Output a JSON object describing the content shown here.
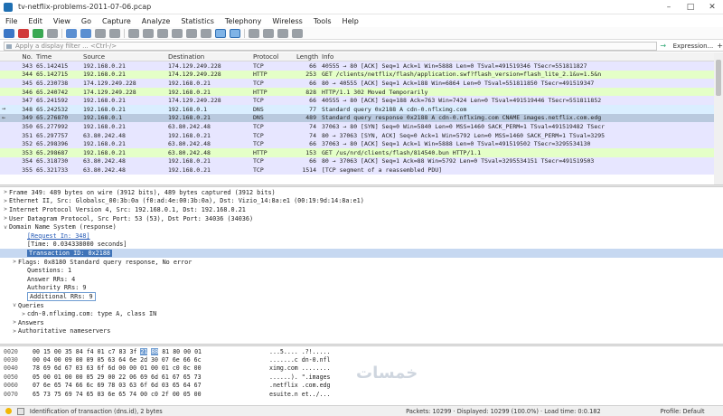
{
  "window": {
    "title": "tv-netflix-problems-2011-07-06.pcap"
  },
  "menu": [
    "File",
    "Edit",
    "View",
    "Go",
    "Capture",
    "Analyze",
    "Statistics",
    "Telephony",
    "Wireless",
    "Tools",
    "Help"
  ],
  "filter": {
    "placeholder": "Apply a display filter ... <Ctrl-/>",
    "expression_label": "Expression...",
    "plus": "+"
  },
  "packet_list": {
    "columns": [
      "No.",
      "Time",
      "Source",
      "Destination",
      "Protocol",
      "Length",
      "Info"
    ],
    "rows": [
      {
        "no": "343",
        "time": "65.142415",
        "src": "192.168.0.21",
        "dst": "174.129.249.228",
        "proto": "TCP",
        "len": "66",
        "info": "40555 → 80 [ACK] Seq=1 Ack=1 Win=5888 Len=0 TSval=491519346 TSecr=551811827",
        "kind": "tcp"
      },
      {
        "no": "344",
        "time": "65.142715",
        "src": "192.168.0.21",
        "dst": "174.129.249.228",
        "proto": "HTTP",
        "len": "253",
        "info": "GET /clients/netflix/flash/application.swf?flash_version=flash_lite_2.1&v=1.5&n",
        "kind": "http"
      },
      {
        "no": "345",
        "time": "65.230738",
        "src": "174.129.249.228",
        "dst": "192.168.0.21",
        "proto": "TCP",
        "len": "66",
        "info": "80 → 40555 [ACK] Seq=1 Ack=188 Win=6864 Len=0 TSval=551811850 TSecr=491519347",
        "kind": "tcp"
      },
      {
        "no": "346",
        "time": "65.240742",
        "src": "174.129.249.228",
        "dst": "192.168.0.21",
        "proto": "HTTP",
        "len": "828",
        "info": "HTTP/1.1 302 Moved Temporarily",
        "kind": "http"
      },
      {
        "no": "347",
        "time": "65.241592",
        "src": "192.168.0.21",
        "dst": "174.129.249.228",
        "proto": "TCP",
        "len": "66",
        "info": "40555 → 80 [ACK] Seq=188 Ack=763 Win=7424 Len=0 TSval=491519446 TSecr=551811852",
        "kind": "tcp"
      },
      {
        "no": "348",
        "time": "65.242532",
        "src": "192.168.0.21",
        "dst": "192.168.0.1",
        "proto": "DNS",
        "len": "77",
        "info": "Standard query 0x2188 A cdn-0.nflximg.com",
        "kind": "dns",
        "mark": "→"
      },
      {
        "no": "349",
        "time": "65.276870",
        "src": "192.168.0.1",
        "dst": "192.168.0.21",
        "proto": "DNS",
        "len": "489",
        "info": "Standard query response 0x2188 A cdn-0.nflximg.com CNAME images.netflix.com.edg",
        "kind": "sel",
        "mark": "←"
      },
      {
        "no": "350",
        "time": "65.277992",
        "src": "192.168.0.21",
        "dst": "63.80.242.48",
        "proto": "TCP",
        "len": "74",
        "info": "37063 → 80 [SYN] Seq=0 Win=5840 Len=0 MSS=1460 SACK_PERM=1 TSval=491519482 TSecr",
        "kind": "tcp"
      },
      {
        "no": "351",
        "time": "65.297757",
        "src": "63.80.242.48",
        "dst": "192.168.0.21",
        "proto": "TCP",
        "len": "74",
        "info": "80 → 37063 [SYN, ACK] Seq=0 Ack=1 Win=5792 Len=0 MSS=1460 SACK_PERM=1 TSval=3295",
        "kind": "tcp"
      },
      {
        "no": "352",
        "time": "65.298396",
        "src": "192.168.0.21",
        "dst": "63.80.242.48",
        "proto": "TCP",
        "len": "66",
        "info": "37063 → 80 [ACK] Seq=1 Ack=1 Win=5888 Len=0 TSval=491519502 TSecr=3295534130",
        "kind": "tcp"
      },
      {
        "no": "353",
        "time": "65.298687",
        "src": "192.168.0.21",
        "dst": "63.80.242.48",
        "proto": "HTTP",
        "len": "153",
        "info": "GET /us/nrd/clients/flash/814540.bun HTTP/1.1",
        "kind": "http"
      },
      {
        "no": "354",
        "time": "65.318730",
        "src": "63.80.242.48",
        "dst": "192.168.0.21",
        "proto": "TCP",
        "len": "66",
        "info": "80 → 37063 [ACK] Seq=1 Ack=88 Win=5792 Len=0 TSval=3295534151 TSecr=491519503",
        "kind": "tcp"
      },
      {
        "no": "355",
        "time": "65.321733",
        "src": "63.80.242.48",
        "dst": "192.168.0.21",
        "proto": "TCP",
        "len": "1514",
        "info": "[TCP segment of a reassembled PDU]",
        "kind": "tcp"
      }
    ]
  },
  "details": [
    {
      "indent": 0,
      "tw": ">",
      "text": "Frame 349: 489 bytes on wire (3912 bits), 489 bytes captured (3912 bits)"
    },
    {
      "indent": 0,
      "tw": ">",
      "text": "Ethernet II, Src: Globalsc_00:3b:0a (f0:ad:4e:00:3b:0a), Dst: Vizio_14:8a:e1 (00:19:9d:14:8a:e1)"
    },
    {
      "indent": 0,
      "tw": ">",
      "text": "Internet Protocol Version 4, Src: 192.168.0.1, Dst: 192.168.0.21"
    },
    {
      "indent": 0,
      "tw": ">",
      "text": "User Datagram Protocol, Src Port: 53 (53), Dst Port: 34036 (34036)"
    },
    {
      "indent": 0,
      "tw": "v",
      "text": "Domain Name System (response)"
    },
    {
      "indent": 2,
      "tw": "",
      "text": "[Request In: 348]",
      "link": true
    },
    {
      "indent": 2,
      "tw": "",
      "text": "[Time: 0.034338000 seconds]"
    },
    {
      "indent": 2,
      "tw": "",
      "text": "Transaction ID: 0x2188",
      "selected": true
    },
    {
      "indent": 1,
      "tw": ">",
      "text": "Flags: 0x8180 Standard query response, No error"
    },
    {
      "indent": 2,
      "tw": "",
      "text": "Questions: 1"
    },
    {
      "indent": 2,
      "tw": "",
      "text": "Answer RRs: 4"
    },
    {
      "indent": 2,
      "tw": "",
      "text": "Authority RRs: 9"
    },
    {
      "indent": 2,
      "tw": "",
      "text": "Additional RRs: 9",
      "boxed": true
    },
    {
      "indent": 1,
      "tw": "v",
      "text": "Queries"
    },
    {
      "indent": 2,
      "tw": ">",
      "text": "cdn-0.nflximg.com: type A, class IN"
    },
    {
      "indent": 1,
      "tw": ">",
      "text": "Answers"
    },
    {
      "indent": 1,
      "tw": ">",
      "text": "Authoritative nameservers"
    }
  ],
  "bytes": [
    {
      "off": "0020",
      "hex": "00 15 00 35 84 f4 01 c7  83 3f 21 88 81 80 00 01",
      "ascii": "...5.... .?!.....",
      "hl": [
        10,
        11
      ]
    },
    {
      "off": "0030",
      "hex": "00 04 00 09 00 09 05 63  64 6e 2d 30 07 6e 66 6c",
      "ascii": ".......c dn-0.nfl"
    },
    {
      "off": "0040",
      "hex": "78 69 6d 67 03 63 6f 6d  00 00 01 00 01 c0 0c 00",
      "ascii": "ximg.com ........"
    },
    {
      "off": "0050",
      "hex": "05 00 01 00 00 05 29 00  22 06 69 6d 61 67 65 73",
      "ascii": "......). \".images"
    },
    {
      "off": "0060",
      "hex": "07 6e 65 74 66 6c 69 78  03 63 6f 6d 03 65 64 67",
      "ascii": ".netflix .com.edg"
    },
    {
      "off": "0070",
      "hex": "65 73 75 69 74 65 03 6e  65 74 00 c0 2f 00 05 00",
      "ascii": "esuite.n et../..."
    }
  ],
  "status": {
    "message": "Identification of transaction (dns.id), 2 bytes",
    "packets": "Packets: 10299 · Displayed: 10299 (100.0%) · Load time: 0:0.182",
    "profile": "Profile: Default"
  },
  "watermark": "خمسات",
  "colors": {
    "tcp": "#e7e6ff",
    "http": "#e4ffc7",
    "dns": "#daeeff",
    "selected": "#b9c9de"
  }
}
